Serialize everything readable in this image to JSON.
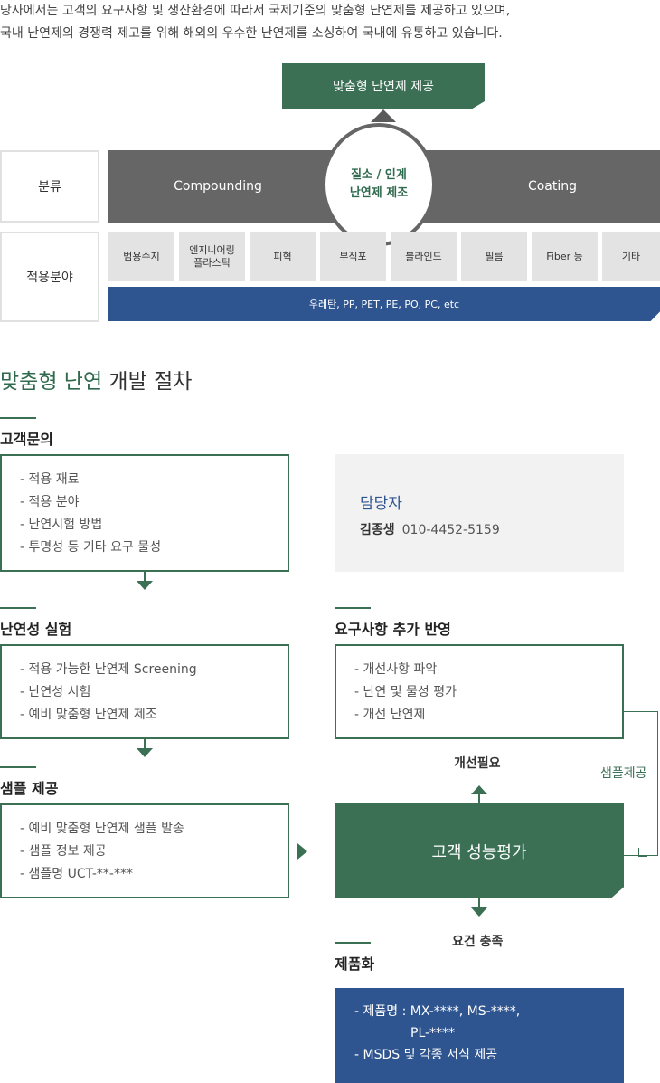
{
  "intro": {
    "line1": "당사에서는 고객의 요구사항 및 생산환경에 따라서 국제기준의 맞춤형 난연제를 제공하고 있으며,",
    "line2": "국내 난연제의 경쟁력 제고를 위해 해외의 우수한 난연제를 소싱하여 국내에 유통하고 있습니다."
  },
  "diagram": {
    "top_tab": "맞춤형 난연제 제공",
    "category_label": "분류",
    "field_label": "적용분야",
    "left_method": "Compounding",
    "right_method": "Coating",
    "center_line1": "질소 / 인계",
    "center_line2": "난연제 제조",
    "applications": [
      {
        "line1": "범용수지",
        "line2": ""
      },
      {
        "line1": "엔지니어링",
        "line2": "플라스틱"
      },
      {
        "line1": "피혁",
        "line2": ""
      },
      {
        "line1": "부직포",
        "line2": ""
      },
      {
        "line1": "블라인드",
        "line2": ""
      },
      {
        "line1": "필름",
        "line2": ""
      },
      {
        "line1": "Fiber 등",
        "line2": ""
      },
      {
        "line1": "기타",
        "line2": ""
      }
    ],
    "materials": "우레탄, PP, PET, PE, PO, PC, etc"
  },
  "process": {
    "title_highlight": "맞춤형 난연",
    "title_rest": " 개발 절차",
    "inquiry": {
      "title": "고객문의",
      "items": [
        "- 적용 재료",
        "- 적용 분야",
        "- 난연시험 방법",
        "- 투명성 등 기타 요구 물성"
      ]
    },
    "contact": {
      "title": "담당자",
      "name": "김종생",
      "phone": "010-4452-5159"
    },
    "test": {
      "title": "난연성 실험",
      "items": [
        "- 적용 가능한 난연제 Screening",
        "- 난연성 시험",
        "- 예비 맞춤형 난연제 제조"
      ]
    },
    "requirements": {
      "title": "요구사항 추가 반영",
      "items": [
        "- 개선사항 파악",
        "- 난연 및 물성 평가",
        "- 개선 난연제"
      ]
    },
    "sample": {
      "title": "샘플 제공",
      "items": [
        "- 예비 맞춤형 난연제 샘플 발송",
        "- 샘플 정보 제공",
        "- 샘플명 UCT-**-***"
      ]
    },
    "improve_label": "개선필요",
    "sample_supply_label": "샘플제공",
    "evaluation": "고객 성능평가",
    "meet_label": "요건 충족",
    "product": {
      "title": "제품화",
      "item1": "- 제품명 : MX-****, MS-****,",
      "item1b": "PL-****",
      "item2": "- MSDS 및 각종 서식 제공"
    }
  },
  "colors": {
    "green": "#3b7055",
    "blue": "#2f5590",
    "gray": "#666666"
  }
}
